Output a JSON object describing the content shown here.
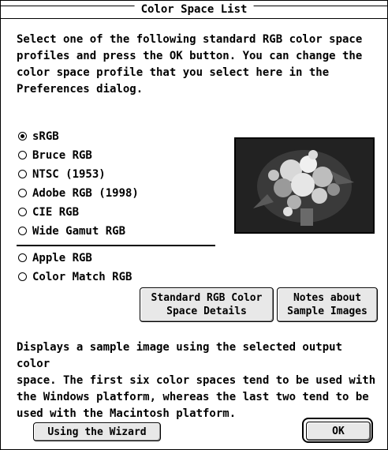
{
  "window": {
    "title": "Color Space List"
  },
  "intro": {
    "lines": [
      "Select one of the following standard RGB color space",
      "profiles and press the OK button. You can change the",
      "color space profile that you select here in the",
      "Preferences dialog."
    ]
  },
  "color_spaces": {
    "selected": "sRGB",
    "group1": [
      "sRGB",
      "Bruce RGB",
      "NTSC (1953)",
      "Adobe RGB (1998)",
      "CIE RGB",
      "Wide Gamut RGB"
    ],
    "group2": [
      "Apple RGB",
      "Color Match RGB"
    ]
  },
  "buttons": {
    "details": [
      "Standard RGB Color",
      "Space Details"
    ],
    "notes": [
      "Notes about",
      "Sample Images"
    ],
    "wizard": "Using the Wizard",
    "ok": "OK"
  },
  "description": {
    "lines": [
      "Displays a sample image using the selected output color",
      "space. The first six color spaces tend to be used with",
      "the Windows platform, whereas the last two tend to be",
      "used with the Macintosh platform."
    ]
  }
}
